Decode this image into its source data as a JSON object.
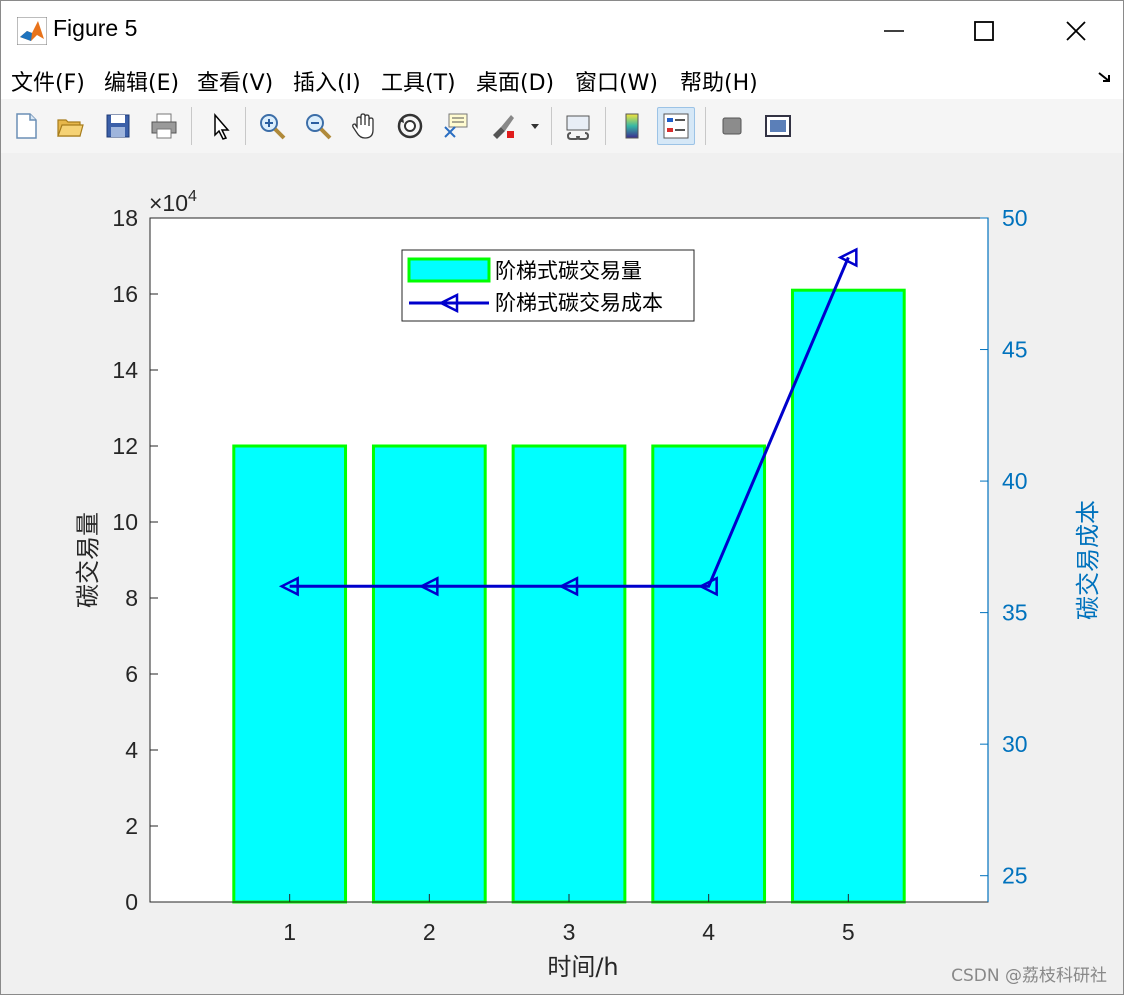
{
  "window": {
    "title": "Figure 5",
    "watermark": "CSDN @荔枝科研社"
  },
  "menu": [
    {
      "label": "文件(F)"
    },
    {
      "label": "编辑(E)"
    },
    {
      "label": "查看(V)"
    },
    {
      "label": "插入(I)"
    },
    {
      "label": "工具(T)"
    },
    {
      "label": "桌面(D)"
    },
    {
      "label": "窗口(W)"
    },
    {
      "label": "帮助(H)"
    }
  ],
  "toolbar": {
    "icons": [
      "new-file-icon",
      "open-folder-icon",
      "save-icon",
      "print-icon",
      "pointer-icon",
      "zoom-in-icon",
      "zoom-out-icon",
      "pan-hand-icon",
      "rotate-3d-icon",
      "data-cursor-icon",
      "brush-icon",
      "link-plot-icon",
      "colorbar-icon",
      "legend-icon",
      "hide-plot-tools-icon",
      "show-plot-tools-icon"
    ]
  },
  "colors": {
    "bar_fill": "#00ffff",
    "bar_edge": "#00ff00",
    "line": "#0000cc",
    "right_axis": "#0072bd",
    "left_axis": "#262626"
  },
  "chart_data": {
    "type": "bar",
    "categories": [
      "1",
      "2",
      "3",
      "4",
      "5"
    ],
    "xlabel": "时间/h",
    "series": [
      {
        "name": "阶梯式碳交易量",
        "type": "bar",
        "axis": "left",
        "values": [
          120000,
          120000,
          120000,
          120000,
          161000
        ]
      },
      {
        "name": "阶梯式碳交易成本",
        "type": "line",
        "axis": "right",
        "marker": "triangle-left",
        "values": [
          36,
          36,
          36,
          36,
          48.5
        ]
      }
    ],
    "left_axis": {
      "label": "碳交易量",
      "ylim": [
        0,
        180000
      ],
      "ticks": [
        0,
        2,
        4,
        6,
        8,
        10,
        12,
        14,
        16,
        18
      ],
      "exponent_label": "×10",
      "exponent": "4"
    },
    "right_axis": {
      "label": "碳交易成本",
      "ylim": [
        24,
        50
      ],
      "ticks": [
        25,
        30,
        35,
        40,
        45,
        50
      ]
    },
    "xlim": [
      0,
      6
    ],
    "legend_position": "top-center",
    "grid": false
  }
}
